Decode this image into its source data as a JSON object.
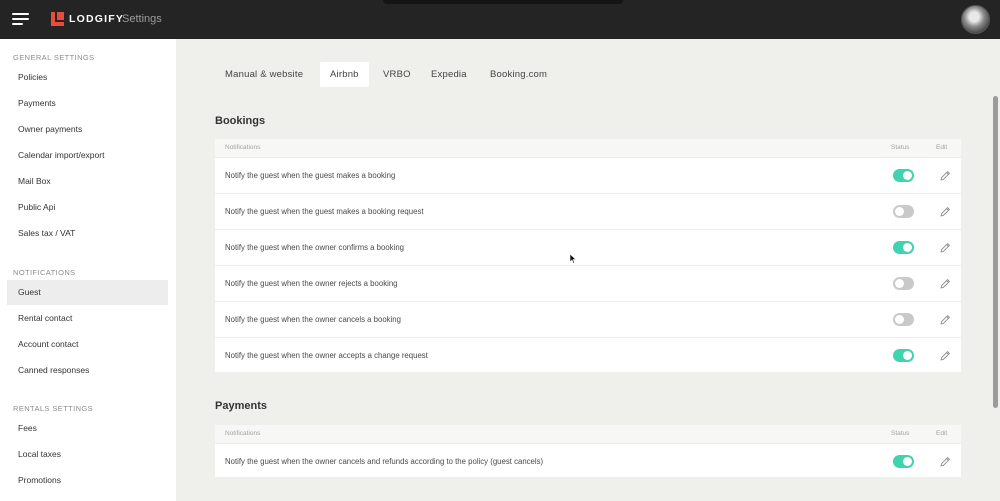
{
  "header": {
    "logo_text": "LODGIFY",
    "breadcrumb": "Settings",
    "menu_icon": "hamburger-icon",
    "avatar": "user-avatar",
    "brand_color": "#e74c3c"
  },
  "sidebar": {
    "sections": [
      {
        "title": "GENERAL SETTINGS",
        "items": [
          "Policies",
          "Payments",
          "Owner payments",
          "Calendar import/export",
          "Mail Box",
          "Public Api",
          "Sales tax / VAT"
        ]
      },
      {
        "title": "NOTIFICATIONS",
        "items": [
          "Guest",
          "Rental contact",
          "Account contact",
          "Canned responses"
        ]
      },
      {
        "title": "RENTALS SETTINGS",
        "items": [
          "Fees",
          "Local taxes",
          "Promotions"
        ]
      }
    ],
    "active_item": "Guest"
  },
  "tabs": [
    "Manual & website",
    "Airbnb",
    "VRBO",
    "Expedia",
    "Booking.com"
  ],
  "active_tab": "Airbnb",
  "bookings": {
    "title": "Bookings",
    "columns": {
      "notifications": "Notifications",
      "status": "Status",
      "edit": "Edit"
    },
    "rows": [
      {
        "label": "Notify the guest when the guest makes a booking",
        "enabled": true
      },
      {
        "label": "Notify the guest when the guest makes a booking request",
        "enabled": false
      },
      {
        "label": "Notify the guest when the owner confirms a booking",
        "enabled": true
      },
      {
        "label": "Notify the guest when the owner rejects a booking",
        "enabled": false
      },
      {
        "label": "Notify the guest when the owner cancels a booking",
        "enabled": false
      },
      {
        "label": "Notify the guest when the owner accepts a change request",
        "enabled": true
      }
    ]
  },
  "payments": {
    "title": "Payments",
    "columns": {
      "notifications": "Notifications",
      "status": "Status",
      "edit": "Edit"
    },
    "rows": [
      {
        "label": "Notify the guest when the owner cancels and refunds according to the policy (guest cancels)",
        "enabled": true
      }
    ]
  },
  "colors": {
    "toggle_on": "#3fd3b0",
    "toggle_off": "#c9c9c9",
    "topbar": "#242424"
  }
}
